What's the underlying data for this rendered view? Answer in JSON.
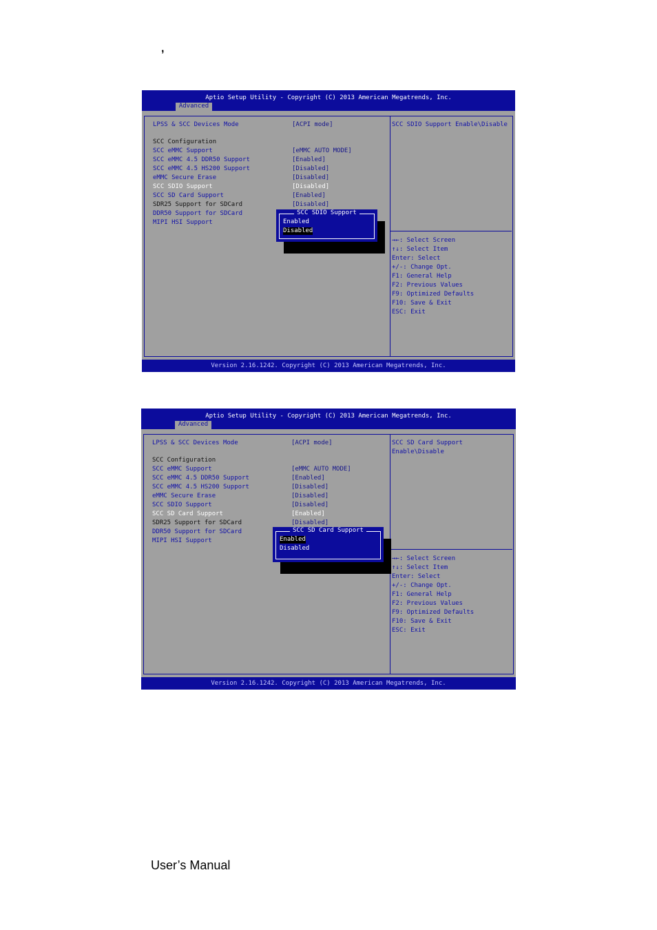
{
  "page": {
    "mark": ",",
    "footer": "User’s Manual"
  },
  "colors": {
    "bios_blue": "#0c0c9c",
    "bios_gray": "#a0a0a0"
  },
  "screens": [
    {
      "title": "Aptio Setup Utility - Copyright (C) 2013 American Megatrends, Inc.",
      "tab": "Advanced",
      "items": [
        {
          "label": "LPSS & SCC Devices Mode",
          "value": "[ACPI mode]",
          "style": "blue"
        },
        {
          "label": "SCC Configuration",
          "value": "",
          "style": "black"
        },
        {
          "label": "SCC eMMC Support",
          "value": "[eMMC AUTO MODE]",
          "style": "blue"
        },
        {
          "label": "SCC eMMC 4.5 DDR50 Support",
          "value": "[Enabled]",
          "style": "blue"
        },
        {
          "label": "SCC eMMC 4.5 HS200 Support",
          "value": "[Disabled]",
          "style": "blue"
        },
        {
          "label": "eMMC Secure Erase",
          "value": "[Disabled]",
          "style": "blue"
        },
        {
          "label": "SCC SDIO Support",
          "value": "[Disabled]",
          "style": "white"
        },
        {
          "label": "SCC SD Card Support",
          "value": "[Enabled]",
          "style": "blue"
        },
        {
          "label": "SDR25 Support for SDCard",
          "value": "[Disabled]",
          "style": "black"
        },
        {
          "label": "DDR50 Support for SDCard",
          "value": "",
          "style": "blue"
        },
        {
          "label": "MIPI HSI Support",
          "value": "",
          "style": "blue"
        }
      ],
      "help": [
        "SCC SDIO Support Enable\\Disable"
      ],
      "keys": [
        "→←: Select Screen",
        "↑↓: Select Item",
        "Enter: Select",
        "+/-: Change Opt.",
        "F1: General Help",
        "F2: Previous Values",
        "F9: Optimized Defaults",
        "F10: Save & Exit",
        "ESC: Exit"
      ],
      "popup": {
        "title": "SCC SDIO Support",
        "options": [
          "Enabled",
          "Disabled"
        ],
        "selected": 1
      },
      "footer": "Version 2.16.1242. Copyright (C) 2013 American Megatrends, Inc."
    },
    {
      "title": "Aptio Setup Utility - Copyright (C) 2013 American Megatrends, Inc.",
      "tab": "Advanced",
      "items": [
        {
          "label": "LPSS & SCC Devices Mode",
          "value": "[ACPI mode]",
          "style": "blue"
        },
        {
          "label": "SCC Configuration",
          "value": "",
          "style": "black"
        },
        {
          "label": "SCC eMMC Support",
          "value": "[eMMC AUTO MODE]",
          "style": "blue"
        },
        {
          "label": "SCC eMMC 4.5 DDR50 Support",
          "value": "[Enabled]",
          "style": "blue"
        },
        {
          "label": "SCC eMMC 4.5 HS200 Support",
          "value": "[Disabled]",
          "style": "blue"
        },
        {
          "label": "eMMC Secure Erase",
          "value": "[Disabled]",
          "style": "blue"
        },
        {
          "label": "SCC SDIO Support",
          "value": "[Disabled]",
          "style": "blue"
        },
        {
          "label": "SCC SD Card Support",
          "value": "[Enabled]",
          "style": "white"
        },
        {
          "label": "SDR25 Support for SDCard",
          "value": "[Disabled]",
          "style": "black"
        },
        {
          "label": "DDR50 Support for SDCard",
          "value": "",
          "style": "blue"
        },
        {
          "label": "MIPI HSI Support",
          "value": "",
          "style": "blue"
        }
      ],
      "help": [
        "SCC SD Card Support",
        "Enable\\Disable"
      ],
      "keys": [
        "→←: Select Screen",
        "↑↓: Select Item",
        "Enter: Select",
        "+/-: Change Opt.",
        "F1: General Help",
        "F2: Previous Values",
        "F9: Optimized Defaults",
        "F10: Save & Exit",
        "ESC: Exit"
      ],
      "popup": {
        "title": "SCC SD Card Support",
        "options": [
          "Enabled",
          "Disabled"
        ],
        "selected": 0
      },
      "footer": "Version 2.16.1242. Copyright (C) 2013 American Megatrends, Inc."
    }
  ]
}
